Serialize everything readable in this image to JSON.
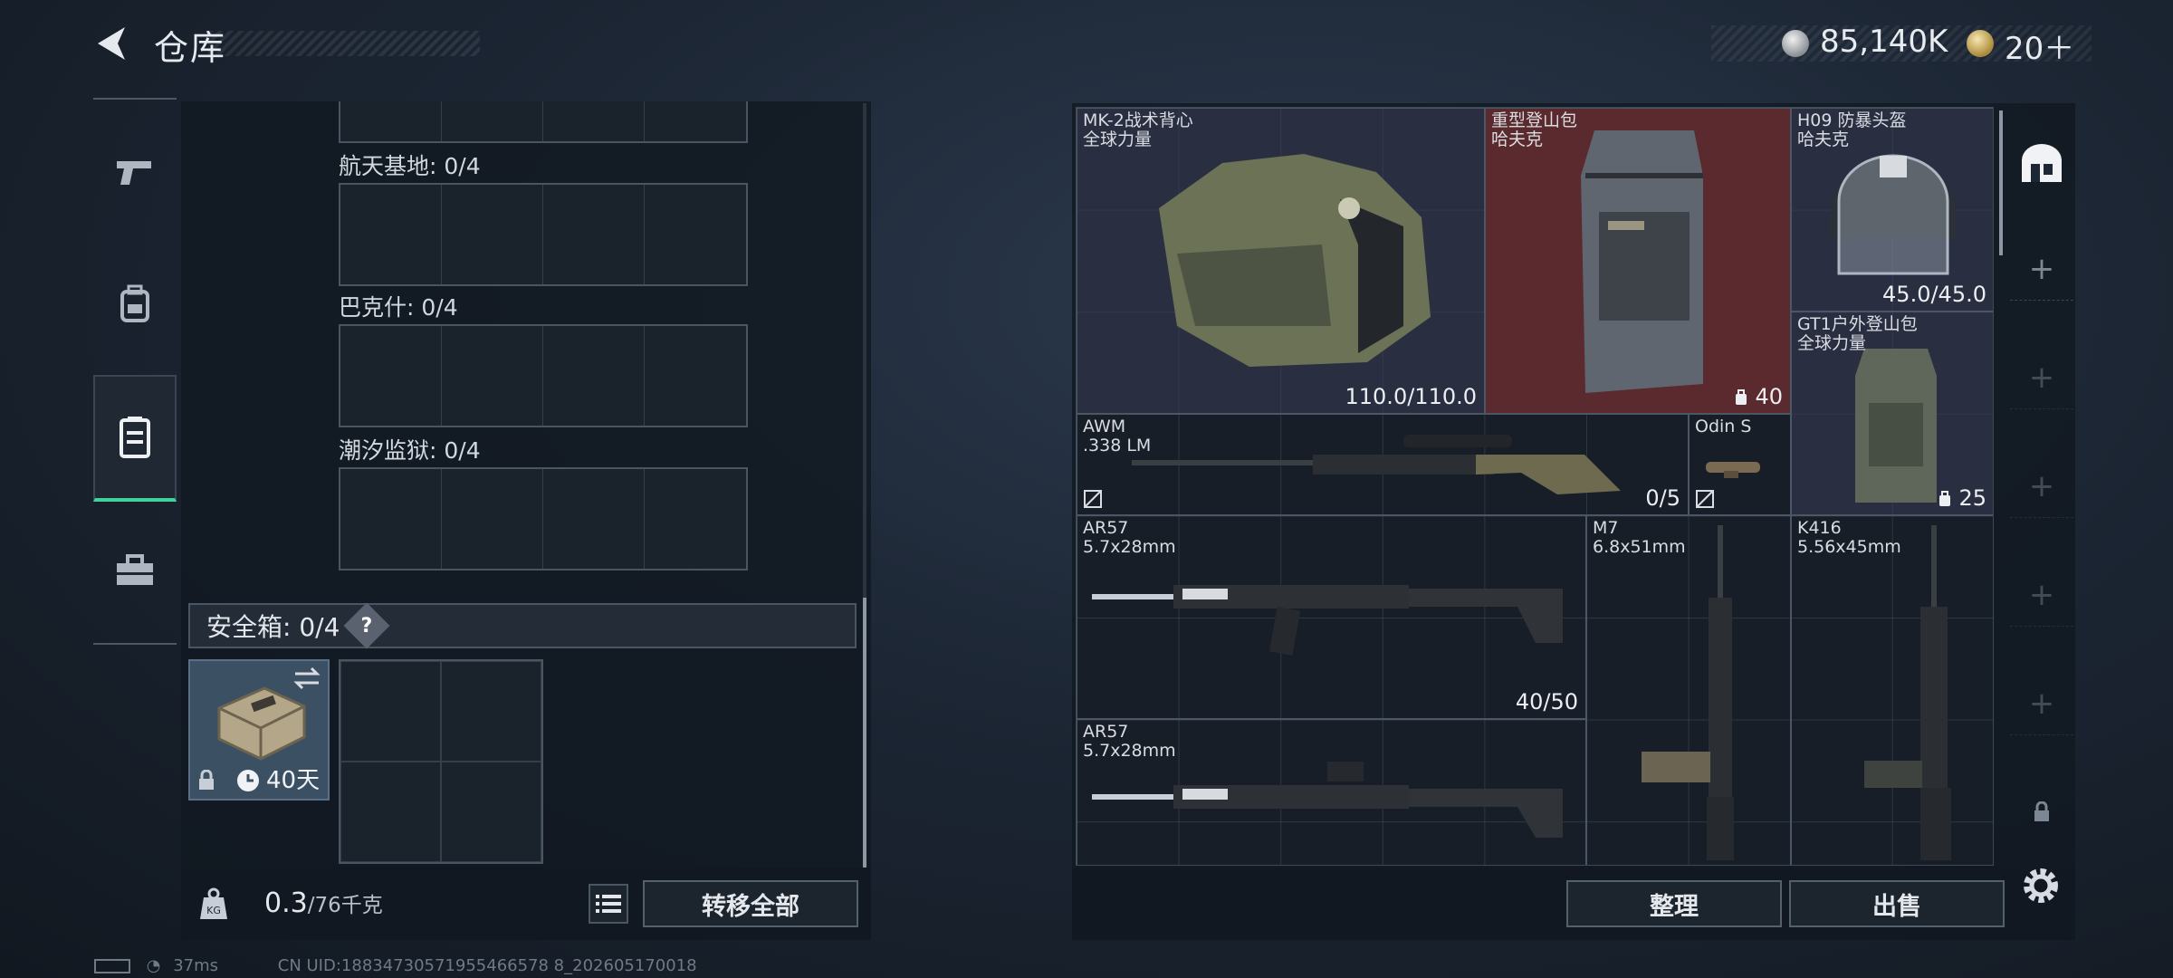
{
  "header": {
    "title": "仓库",
    "silver_amount": "85,140K",
    "gold_amount": "20＋"
  },
  "left_panel": {
    "sections": [
      {
        "label": "航天基地: 0/4"
      },
      {
        "label": "巴克什: 0/4"
      },
      {
        "label": "潮汐监狱: 0/4"
      }
    ],
    "safe_box": {
      "label": "安全箱: 0/4",
      "help": "?",
      "item_days": "40天"
    },
    "weight_value": "0.3",
    "weight_max": "/76千克",
    "transfer_all": "转移全部"
  },
  "stash": {
    "items": [
      {
        "name": "MK-2战术背心\n全球力量",
        "value": "110.0/110.0"
      },
      {
        "name": "重型登山包\n哈夫克",
        "value": "40"
      },
      {
        "name": "H09 防暴头盔\n哈夫克",
        "value": "45.0/45.0"
      },
      {
        "name": "GT1户外登山包\n全球力量",
        "value": "25"
      },
      {
        "name": "AWM\n.338 LM",
        "value": "0/5"
      },
      {
        "name": "Odin S",
        "value": ""
      },
      {
        "name": "AR57\n5.7x28mm",
        "value": "40/50"
      },
      {
        "name": "M7\n6.8x51mm",
        "value": ""
      },
      {
        "name": "K416\n5.56x45mm",
        "value": ""
      },
      {
        "name": "AR57\n5.7x28mm",
        "value": ""
      }
    ],
    "sort_label": "整理",
    "sell_label": "出售"
  },
  "status": {
    "ping": "37ms",
    "uid": "CN UID:18834730571955466578 8_202605170018"
  },
  "colors": {
    "accent_green": "#3fd49a",
    "backpack_red": "#5a2a2e"
  }
}
